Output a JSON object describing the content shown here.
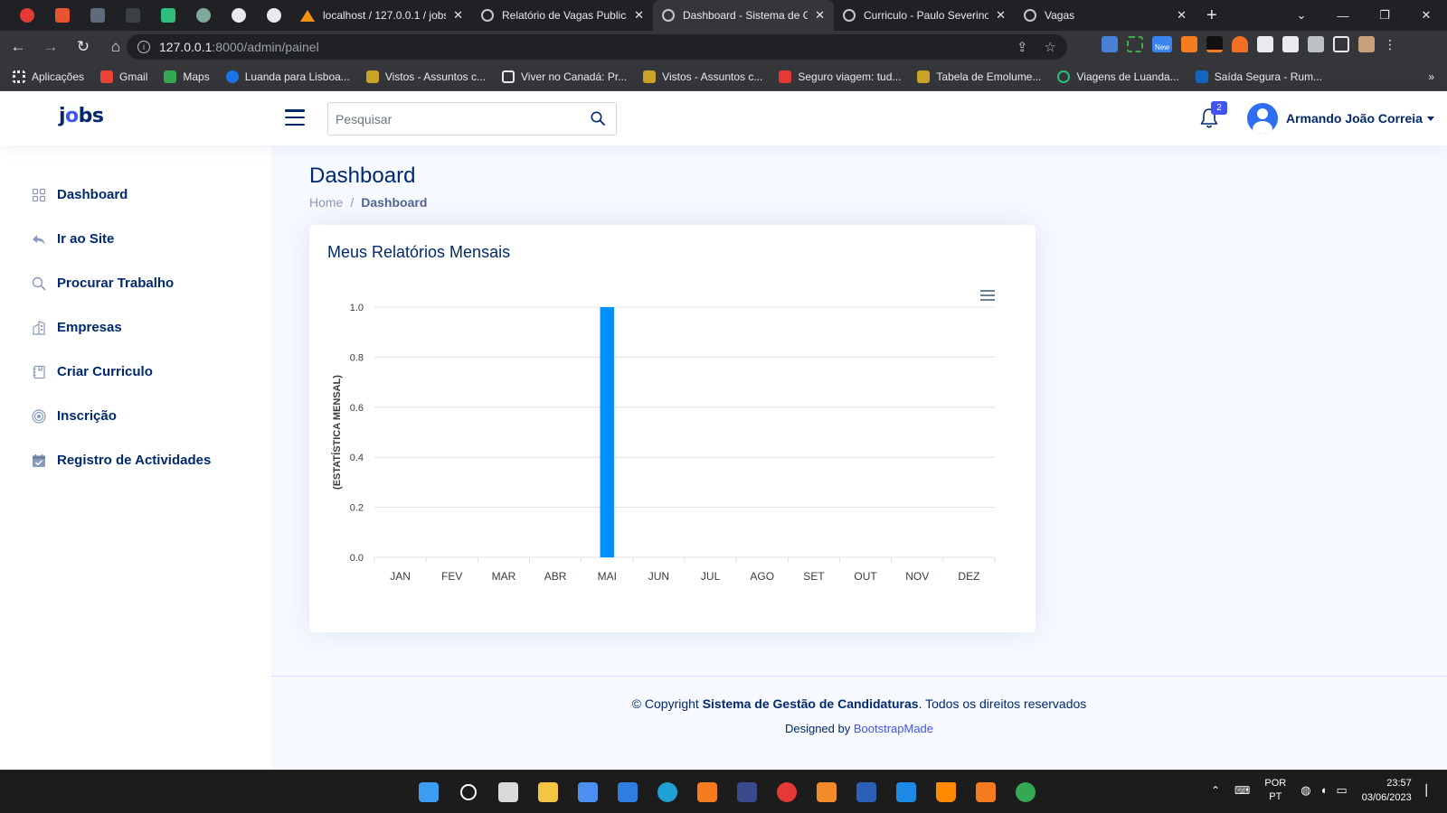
{
  "browser": {
    "tabs": [
      {
        "title": "localhost / 127.0.0.1 / jobs"
      },
      {
        "title": "Relatório de Vagas Publicadas"
      },
      {
        "title": "Dashboard - Sistema de Gestão",
        "active": true
      },
      {
        "title": "Curriculo - Paulo Severino"
      },
      {
        "title": "Vagas"
      }
    ],
    "new_tab": "+",
    "address": {
      "host": "127.0.0.1",
      "path": ":8000/admin/painel"
    },
    "bookmarks": [
      {
        "label": "Aplicações"
      },
      {
        "label": "Gmail"
      },
      {
        "label": "Maps"
      },
      {
        "label": "Luanda para Lisboa..."
      },
      {
        "label": "Vistos - Assuntos c..."
      },
      {
        "label": "Viver no Canadá: Pr..."
      },
      {
        "label": "Vistos - Assuntos c..."
      },
      {
        "label": "Seguro viagem: tud..."
      },
      {
        "label": "Tabela de Emolume..."
      },
      {
        "label": "Viagens de Luanda..."
      },
      {
        "label": "Saída Segura - Rum..."
      }
    ],
    "ext_badge": "New"
  },
  "header": {
    "logo_pre": "j",
    "logo_o": "o",
    "logo_post": "bs",
    "search_placeholder": "Pesquisar",
    "notif_count": "2",
    "user_name": "Armando João Correia"
  },
  "sidebar": {
    "items": [
      {
        "label": "Dashboard",
        "icon": "grid-icon"
      },
      {
        "label": "Ir ao Site",
        "icon": "reply-icon"
      },
      {
        "label": "Procurar Trabalho",
        "icon": "search-icon"
      },
      {
        "label": "Empresas",
        "icon": "building-icon"
      },
      {
        "label": "Criar Curriculo",
        "icon": "journal-icon"
      },
      {
        "label": "Inscrição",
        "icon": "target-icon"
      },
      {
        "label": "Registro de Actividades",
        "icon": "calendar-icon"
      }
    ]
  },
  "main": {
    "title": "Dashboard",
    "breadcrumb": {
      "home": "Home",
      "sep": "/",
      "current": "Dashboard"
    },
    "card_title": "Meus Relatórios Mensais"
  },
  "chart_data": {
    "type": "bar",
    "categories": [
      "JAN",
      "FEV",
      "MAR",
      "ABR",
      "MAI",
      "JUN",
      "JUL",
      "AGO",
      "SET",
      "OUT",
      "NOV",
      "DEZ"
    ],
    "values": [
      0,
      0,
      0,
      0,
      1,
      0,
      0,
      0,
      0,
      0,
      0,
      0
    ],
    "ylabel": "(ESTATÍSTICA MENSAL)",
    "ylim": [
      0,
      1
    ],
    "yticks": [
      "0.0",
      "0.2",
      "0.4",
      "0.6",
      "0.8",
      "1.0"
    ],
    "grid": true,
    "bar_color": "#008ffb"
  },
  "footer": {
    "copy_prefix": "© Copyright ",
    "copy_strong": "Sistema de Gestão de Candidaturas",
    "copy_suffix": ". Todos os direitos reservados",
    "designed_by": "Designed by ",
    "designer": "BootstrapMade"
  },
  "taskbar": {
    "lang": "POR",
    "region": "PT",
    "time": "23:57",
    "date": "03/06/2023"
  },
  "colors": {
    "brand": "#012970",
    "accent": "#4154f1",
    "bar": "#008ffb"
  }
}
